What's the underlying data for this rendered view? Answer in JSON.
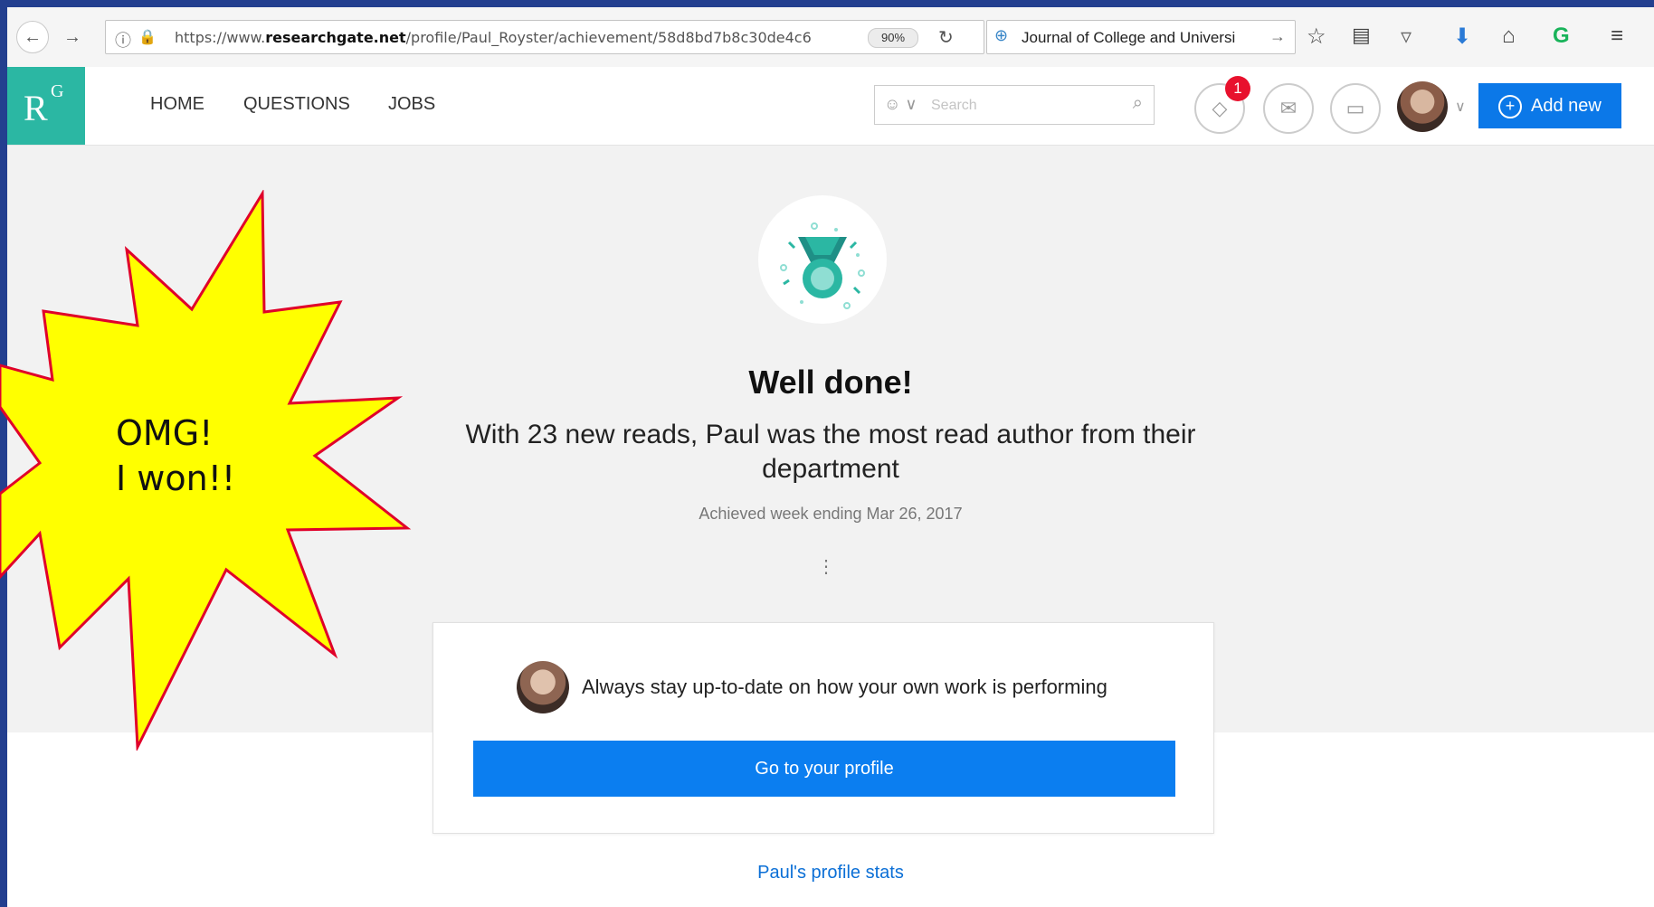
{
  "browser": {
    "url_prefix": "https://www.",
    "url_domain": "researchgate.net",
    "url_path": "/profile/Paul_Royster/achievement/58d8bd7b8c30de4c6",
    "zoom": "90%",
    "search_text": "Journal of College and Universi"
  },
  "header": {
    "logo_r": "R",
    "logo_g": "G",
    "nav": [
      "HOME",
      "QUESTIONS",
      "JOBS"
    ],
    "search_placeholder": "Search",
    "notification_count": "1",
    "add_new_label": "Add new"
  },
  "achievement": {
    "title": "Well done!",
    "subtitle": "With 23 new reads, Paul was the most read author from their department",
    "achieved": "Achieved week ending Mar 26, 2017",
    "more": "⋮"
  },
  "card": {
    "message": "Always stay up-to-date on how your own work is performing",
    "cta": "Go to your profile"
  },
  "stats_link": "Paul's profile stats",
  "callout": {
    "line1": "OMG!",
    "line2": "I won!!"
  },
  "colors": {
    "accent": "#0b7ef0",
    "brand": "#2bb7a3",
    "badge": "#e8112d",
    "starburst_fill": "#ffff00",
    "starburst_stroke": "#e0002a"
  }
}
